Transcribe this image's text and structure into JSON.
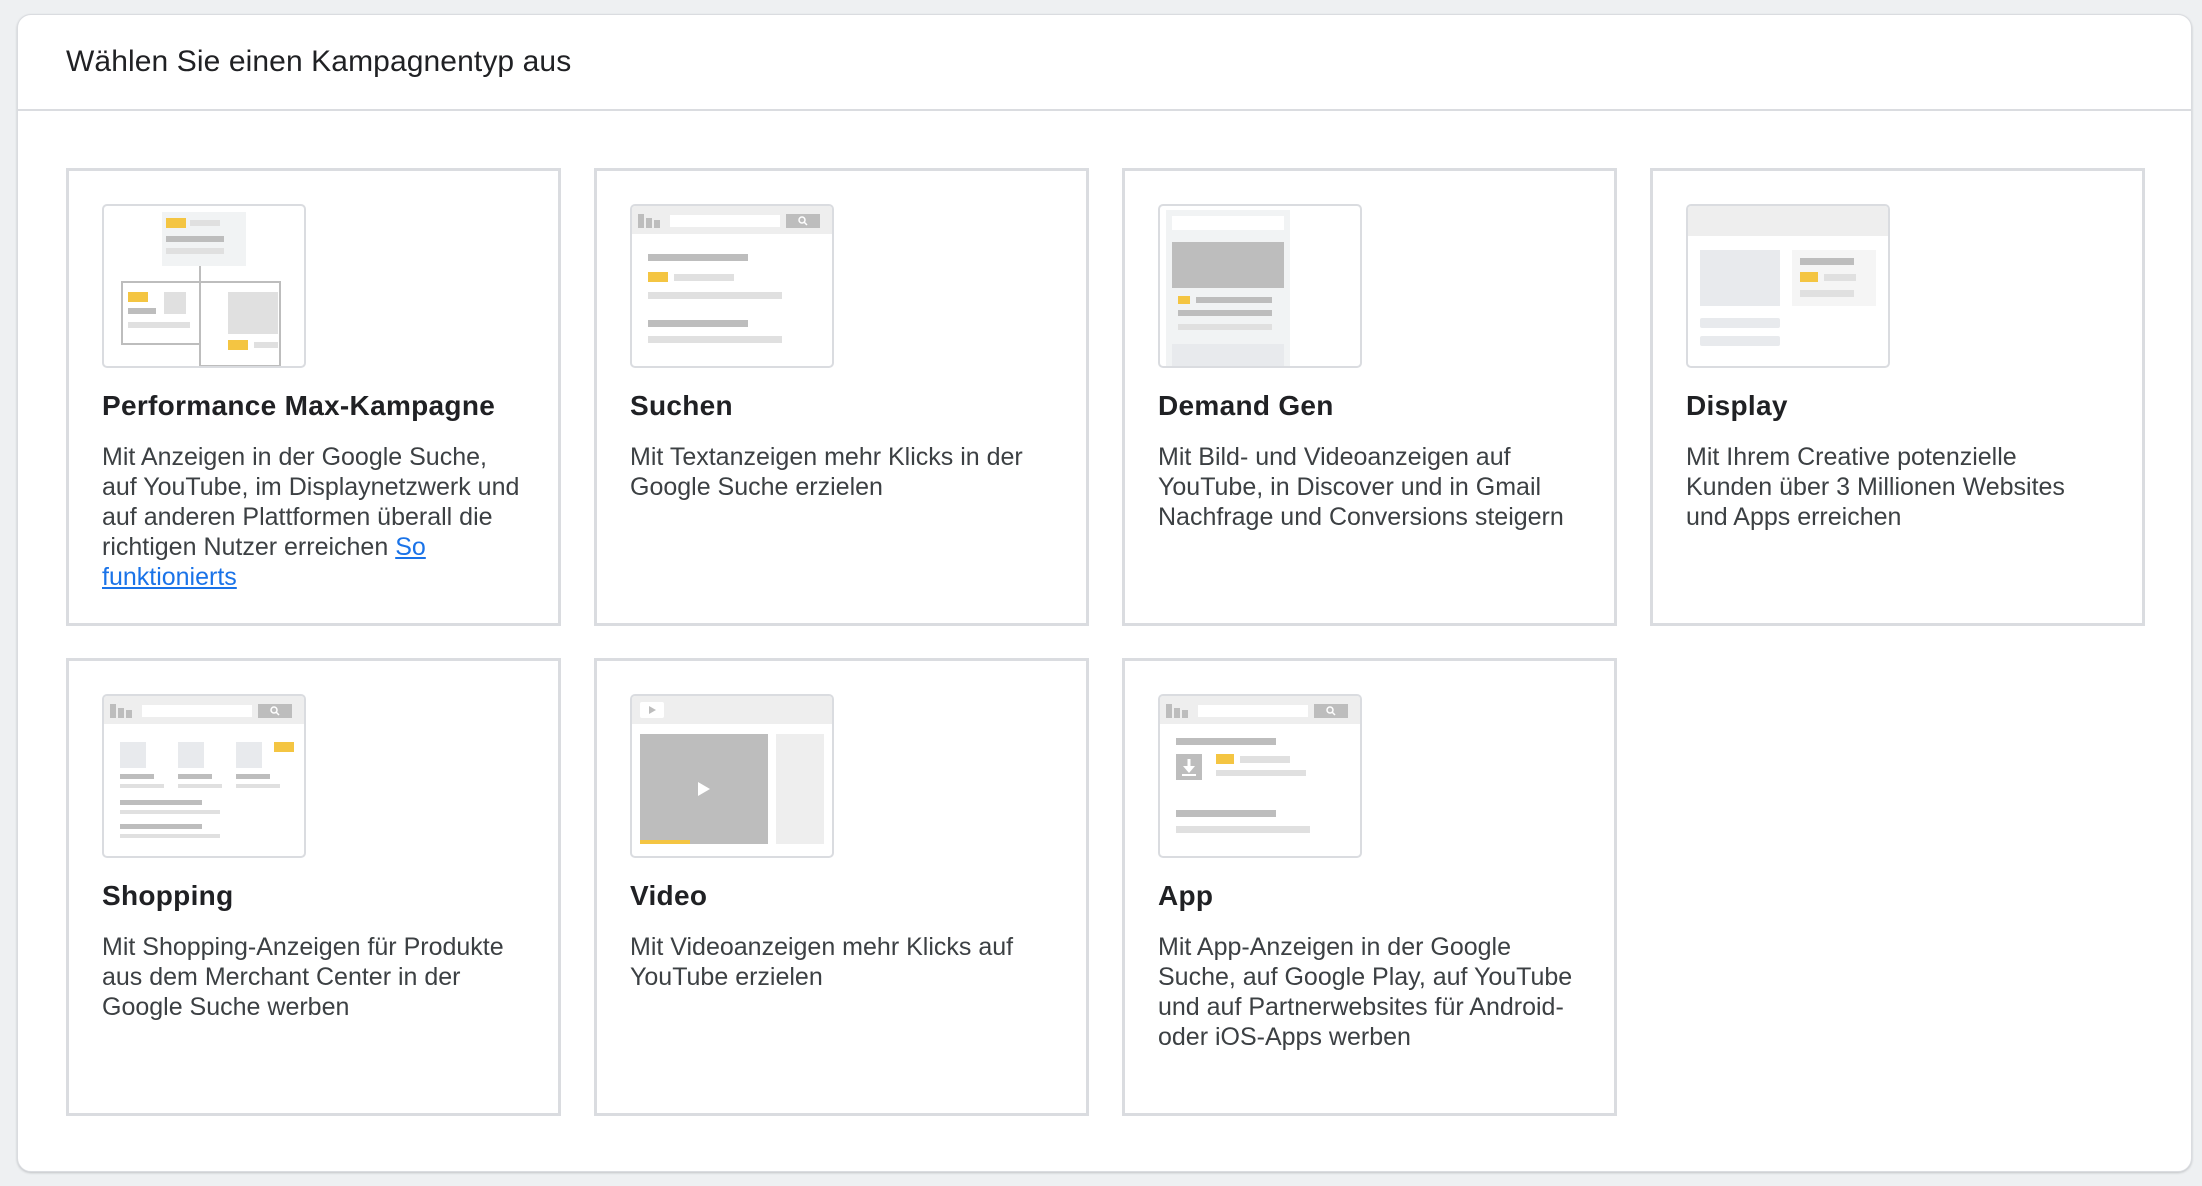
{
  "header": {
    "title": "Wählen Sie einen Kampagnentyp aus"
  },
  "colors": {
    "accent": "#f4c542",
    "border": "#dadce0",
    "illustration_gray": "#bdbdbd",
    "link": "#1a73e8"
  },
  "cards": [
    {
      "title": "Performance Max-Kampagne",
      "description": "Mit Anzeigen in der Google Suche, auf YouTube, im Displaynetzwerk und auf anderen Plattformen überall die richtigen Nutzer erreichen",
      "link": "So funktionierts",
      "icon": "performance-max-illustration"
    },
    {
      "title": "Suchen",
      "description": "Mit Textanzeigen mehr Klicks in der Google Suche erzielen",
      "icon": "search-illustration"
    },
    {
      "title": "Demand Gen",
      "description": "Mit Bild- und Videoanzeigen auf YouTube, in Discover und in Gmail Nachfrage und Conversions steigern",
      "icon": "demand-gen-illustration"
    },
    {
      "title": "Display",
      "description": "Mit Ihrem Creative potenzielle Kunden über 3 Millionen Websites und Apps erreichen",
      "icon": "display-illustration"
    },
    {
      "title": "Shopping",
      "description": "Mit Shopping-Anzeigen für Produkte aus dem Merchant Center in der Google Suche werben",
      "icon": "shopping-illustration"
    },
    {
      "title": "Video",
      "description": "Mit Videoanzeigen mehr Klicks auf YouTube erzielen",
      "icon": "video-illustration"
    },
    {
      "title": "App",
      "description": "Mit App-Anzeigen in der Google Suche, auf Google Play, auf YouTube und auf Partnerwebsites für Android- oder iOS-Apps werben",
      "icon": "app-illustration"
    }
  ]
}
